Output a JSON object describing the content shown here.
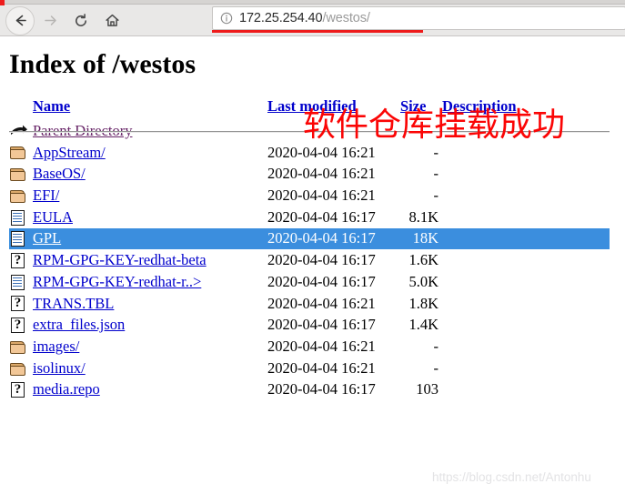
{
  "browser": {
    "back_label": "Back",
    "forward_label": "Forward",
    "reload_label": "Reload",
    "home_label": "Home",
    "url_host": "172.25.254.40",
    "url_path": "/westos/",
    "url_full": "172.25.254.40/westos/",
    "site_info_label": "Site information"
  },
  "page": {
    "title": "Index of /westos",
    "headers": {
      "name": "Name",
      "last_modified": "Last modified",
      "size": "Size",
      "description": "Description"
    },
    "rows": [
      {
        "icon": "back-arrow-icon",
        "name": "Parent Directory",
        "date": "",
        "size": "-",
        "desc": "",
        "selected": false,
        "parent": true
      },
      {
        "icon": "folder-icon",
        "name": "AppStream/",
        "date": "2020-04-04 16:21",
        "size": "-",
        "desc": "",
        "selected": false,
        "parent": false
      },
      {
        "icon": "folder-icon",
        "name": "BaseOS/",
        "date": "2020-04-04 16:21",
        "size": "-",
        "desc": "",
        "selected": false,
        "parent": false
      },
      {
        "icon": "folder-icon",
        "name": "EFI/",
        "date": "2020-04-04 16:21",
        "size": "-",
        "desc": "",
        "selected": false,
        "parent": false
      },
      {
        "icon": "text-document-icon",
        "name": "EULA",
        "date": "2020-04-04 16:17",
        "size": "8.1K",
        "desc": "",
        "selected": false,
        "parent": false
      },
      {
        "icon": "text-document-icon",
        "name": "GPL",
        "date": "2020-04-04 16:17",
        "size": "18K",
        "desc": "",
        "selected": true,
        "parent": false
      },
      {
        "icon": "unknown-file-icon",
        "name": "RPM-GPG-KEY-redhat-beta",
        "date": "2020-04-04 16:17",
        "size": "1.6K",
        "desc": "",
        "selected": false,
        "parent": false
      },
      {
        "icon": "text-document-icon",
        "name": "RPM-GPG-KEY-redhat-r..>",
        "date": "2020-04-04 16:17",
        "size": "5.0K",
        "desc": "",
        "selected": false,
        "parent": false
      },
      {
        "icon": "unknown-file-icon",
        "name": "TRANS.TBL",
        "date": "2020-04-04 16:21",
        "size": "1.8K",
        "desc": "",
        "selected": false,
        "parent": false
      },
      {
        "icon": "unknown-file-icon",
        "name": "extra_files.json",
        "date": "2020-04-04 16:17",
        "size": "1.4K",
        "desc": "",
        "selected": false,
        "parent": false
      },
      {
        "icon": "folder-icon",
        "name": "images/",
        "date": "2020-04-04 16:21",
        "size": "-",
        "desc": "",
        "selected": false,
        "parent": false
      },
      {
        "icon": "folder-icon",
        "name": "isolinux/",
        "date": "2020-04-04 16:21",
        "size": "-",
        "desc": "",
        "selected": false,
        "parent": false
      },
      {
        "icon": "unknown-file-icon",
        "name": "media.repo",
        "date": "2020-04-04 16:17",
        "size": "103",
        "desc": "",
        "selected": false,
        "parent": false
      }
    ]
  },
  "annotations": {
    "red_text": "软件仓库挂载成功",
    "red_color": "#fb0505",
    "watermark": "https://blog.csdn.net/Antonhu"
  },
  "colors": {
    "link": "#0000cc",
    "visited_link": "#662266",
    "selection_bg": "#3b8ede",
    "selection_fg": "#ffffff",
    "chrome_bg": "#e9e8e7"
  }
}
